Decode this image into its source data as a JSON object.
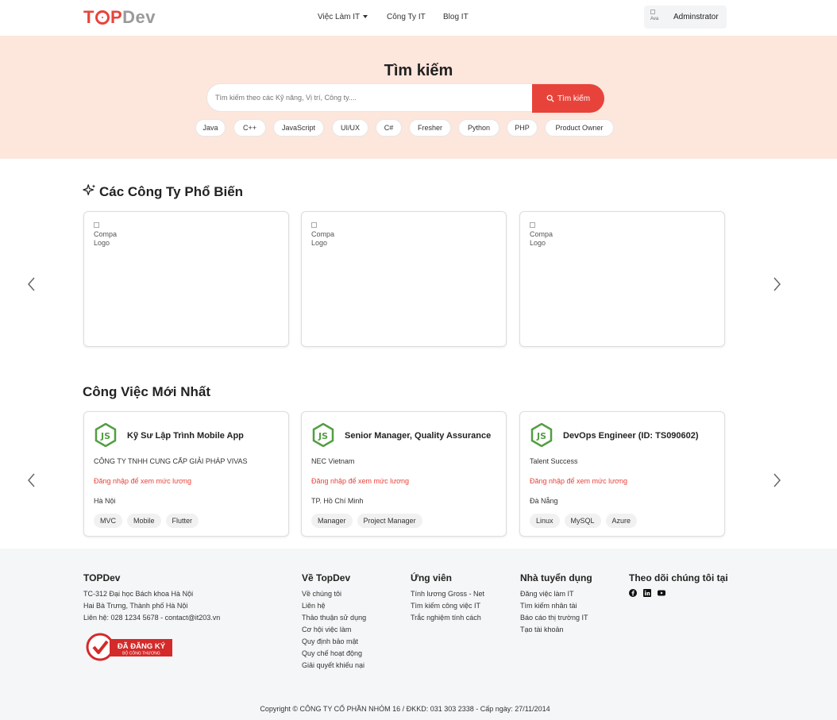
{
  "header": {
    "logo_top": "T",
    "logo_p": "P",
    "logo_dev": "Dev",
    "nav": {
      "jobs": "Việc Làm IT",
      "companies": "Công Ty IT",
      "blog": "Blog IT"
    },
    "user": {
      "avatar_alt": "Ava",
      "name": "Adminstrator"
    }
  },
  "search": {
    "title": "Tìm kiếm",
    "placeholder": "Tìm kiếm theo các Kỹ năng, Vị trí, Công ty....",
    "button": "Tìm kiếm",
    "tags": [
      "Java",
      "C++",
      "JavaScript",
      "UI/UX",
      "C#",
      "Fresher",
      "Python",
      "PHP",
      "Product Owner"
    ]
  },
  "companies": {
    "title": "Các Công Ty Phổ Biến",
    "cards": [
      {
        "logo_alt": "Compa Logo"
      },
      {
        "logo_alt": "Compa Logo"
      },
      {
        "logo_alt": "Compa Logo"
      }
    ]
  },
  "jobs": {
    "title": "Công Việc Mới Nhất",
    "cards": [
      {
        "title": "Kỹ Sư Lập Trình Mobile App",
        "company": "CÔNG TY TNHH CUNG CẤP GIẢI PHÁP VIVAS",
        "salary": "Đăng nhập để xem mức lương",
        "location": "Hà Nội",
        "tags": [
          "MVC",
          "Mobile",
          "Flutter"
        ]
      },
      {
        "title": "Senior Manager, Quality Assurance",
        "company": "NEC Vietnam",
        "salary": "Đăng nhập để xem mức lương",
        "location": "TP. Hồ Chí Minh",
        "tags": [
          "Manager",
          "Project Manager"
        ]
      },
      {
        "title": "DevOps Engineer (ID: TS090602)",
        "company": "Talent Success",
        "salary": "Đăng nhập để xem mức lương",
        "location": "Đà Nẵng",
        "tags": [
          "Linux",
          "MySQL",
          "Azure"
        ]
      }
    ]
  },
  "footer": {
    "about": {
      "title": "TOPDev",
      "lines": [
        "TC-312 Đại học Bách khoa Hà Nội",
        "Hai Bà Trưng, Thành phố Hà Nội",
        "Liên hệ: 028 1234 5678 - contact@it203.vn"
      ],
      "badge_text": "ĐÃ ĐĂNG KÝ",
      "badge_sub": "BỘ CÔNG THƯƠNG"
    },
    "ve_topdev": {
      "title": "Về TopDev",
      "links": [
        "Về chúng tôi",
        "Liên hệ",
        "Thảo thuận sử dụng",
        "Cơ hội việc làm",
        "Quy định bảo mật",
        "Quy chế hoạt động",
        "Giải quyết khiếu nại"
      ]
    },
    "ung_vien": {
      "title": "Ứng viên",
      "links": [
        "Tính lương Gross - Net",
        "Tìm kiếm công việc IT",
        "Trắc nghiệm tính cách"
      ]
    },
    "nha_tuyen_dung": {
      "title": "Nhà tuyển dụng",
      "links": [
        "Đăng việc làm IT",
        "Tìm kiếm nhân tài",
        "Báo cáo thị trường IT",
        "Tạo tài khoản"
      ]
    },
    "follow": {
      "title": "Theo dõi chúng tôi tại",
      "icons": [
        "facebook-icon",
        "linkedin-icon",
        "youtube-icon"
      ]
    },
    "copyright": "Copyright © CÔNG TY CỔ PHẦN NHÓM 16 / ĐKKD: 031 303 2338 - Cấp ngày: 27/11/2014"
  },
  "colors": {
    "brand": "#e8433a",
    "banner_bg": "#fde6dc",
    "footer_bg": "#f5f6f7",
    "node_green": "#539e43"
  }
}
